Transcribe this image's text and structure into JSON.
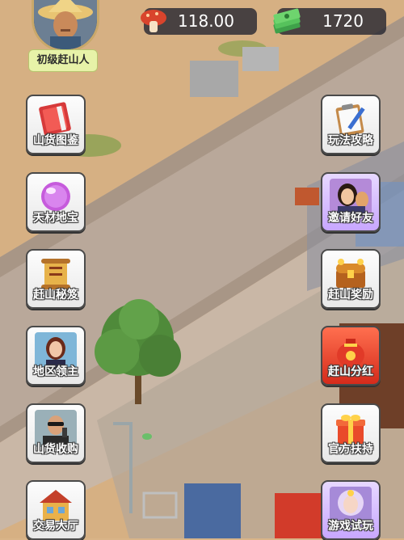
{
  "player": {
    "rank": "初级赶山人"
  },
  "currencies": {
    "mushroom": {
      "icon": "mushroom-icon",
      "value": "118.00"
    },
    "cash": {
      "icon": "cash-stack-icon",
      "value": "1720"
    }
  },
  "menu_left": [
    {
      "label": "山货图鉴",
      "icon": "red-book-icon"
    },
    {
      "label": "天材地宝",
      "icon": "purple-orb-icon"
    },
    {
      "label": "赶山秘笈",
      "icon": "scroll-icon"
    },
    {
      "label": "地区领主",
      "icon": "lady-portrait-icon"
    },
    {
      "label": "山货收购",
      "icon": "buyer-portrait-icon"
    },
    {
      "label": "交易大厅",
      "icon": "trading-hall-icon"
    }
  ],
  "menu_right": [
    {
      "label": "玩法攻略",
      "icon": "clipboard-pen-icon"
    },
    {
      "label": "邀请好友",
      "icon": "friends-portrait-icon"
    },
    {
      "label": "赶山奖励",
      "icon": "treasure-chest-icon"
    },
    {
      "label": "赶山分红",
      "icon": "red-money-bag-icon"
    },
    {
      "label": "官方扶持",
      "icon": "gift-box-icon"
    },
    {
      "label": "游戏试玩",
      "icon": "fantasy-character-icon"
    }
  ]
}
